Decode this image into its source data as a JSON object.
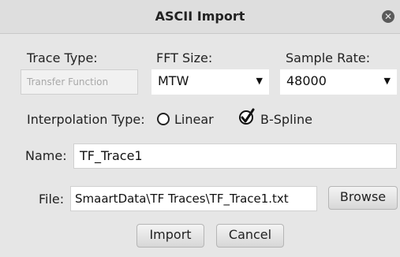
{
  "window": {
    "title": "ASCII Import"
  },
  "trace_type": {
    "label": "Trace Type:",
    "value": "Transfer Function"
  },
  "fft_size": {
    "label": "FFT Size:",
    "value": "MTW"
  },
  "sample_rate": {
    "label": "Sample Rate:",
    "value": "48000"
  },
  "interpolation": {
    "label": "Interpolation Type:",
    "options": [
      "Linear",
      "B-Spline"
    ],
    "selected": "B-Spline"
  },
  "name": {
    "label": "Name:",
    "value": "TF_Trace1"
  },
  "file": {
    "label": "File:",
    "value": "SmaartData\\TF Traces\\TF_Trace1.txt"
  },
  "buttons": {
    "browse": "Browse",
    "import": "Import",
    "cancel": "Cancel"
  }
}
